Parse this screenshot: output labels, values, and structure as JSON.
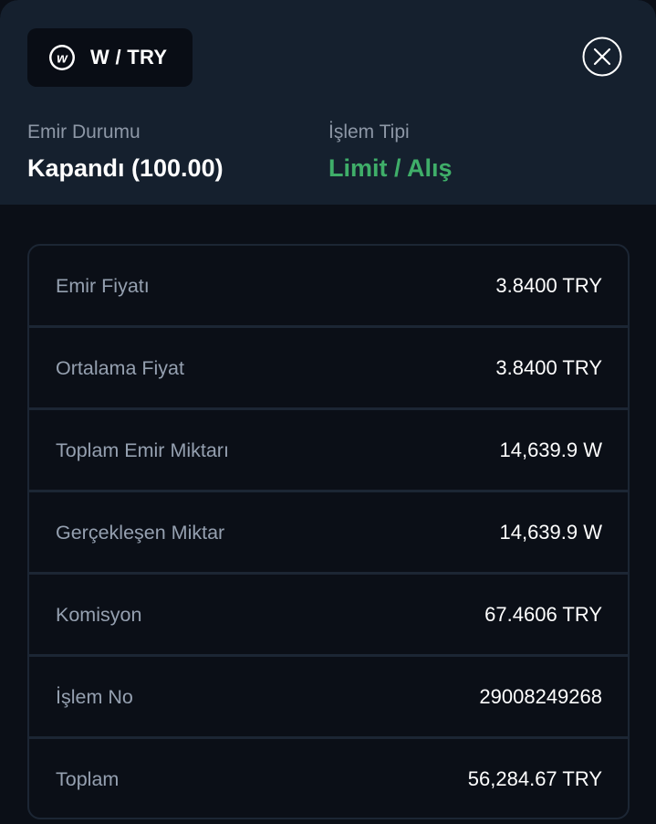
{
  "header": {
    "pair": "W / TRY",
    "coin_icon": "wormhole-w-icon",
    "close_icon": "close-icon",
    "order_status_label": "Emir Durumu",
    "order_status_value": "Kapandı (100.00)",
    "trade_type_label": "İşlem Tipi",
    "trade_type_value": "Limit / Alış",
    "trade_type_color": "#3fae69"
  },
  "details": [
    {
      "label": "Emir Fiyatı",
      "value": "3.8400 TRY"
    },
    {
      "label": "Ortalama Fiyat",
      "value": "3.8400 TRY"
    },
    {
      "label": "Toplam Emir Miktarı",
      "value": "14,639.9 W"
    },
    {
      "label": "Gerçekleşen Miktar",
      "value": "14,639.9 W"
    },
    {
      "label": "Komisyon",
      "value": "67.4606 TRY"
    },
    {
      "label": "İşlem No",
      "value": "29008249268"
    },
    {
      "label": "Toplam",
      "value": "56,284.67 TRY"
    }
  ]
}
